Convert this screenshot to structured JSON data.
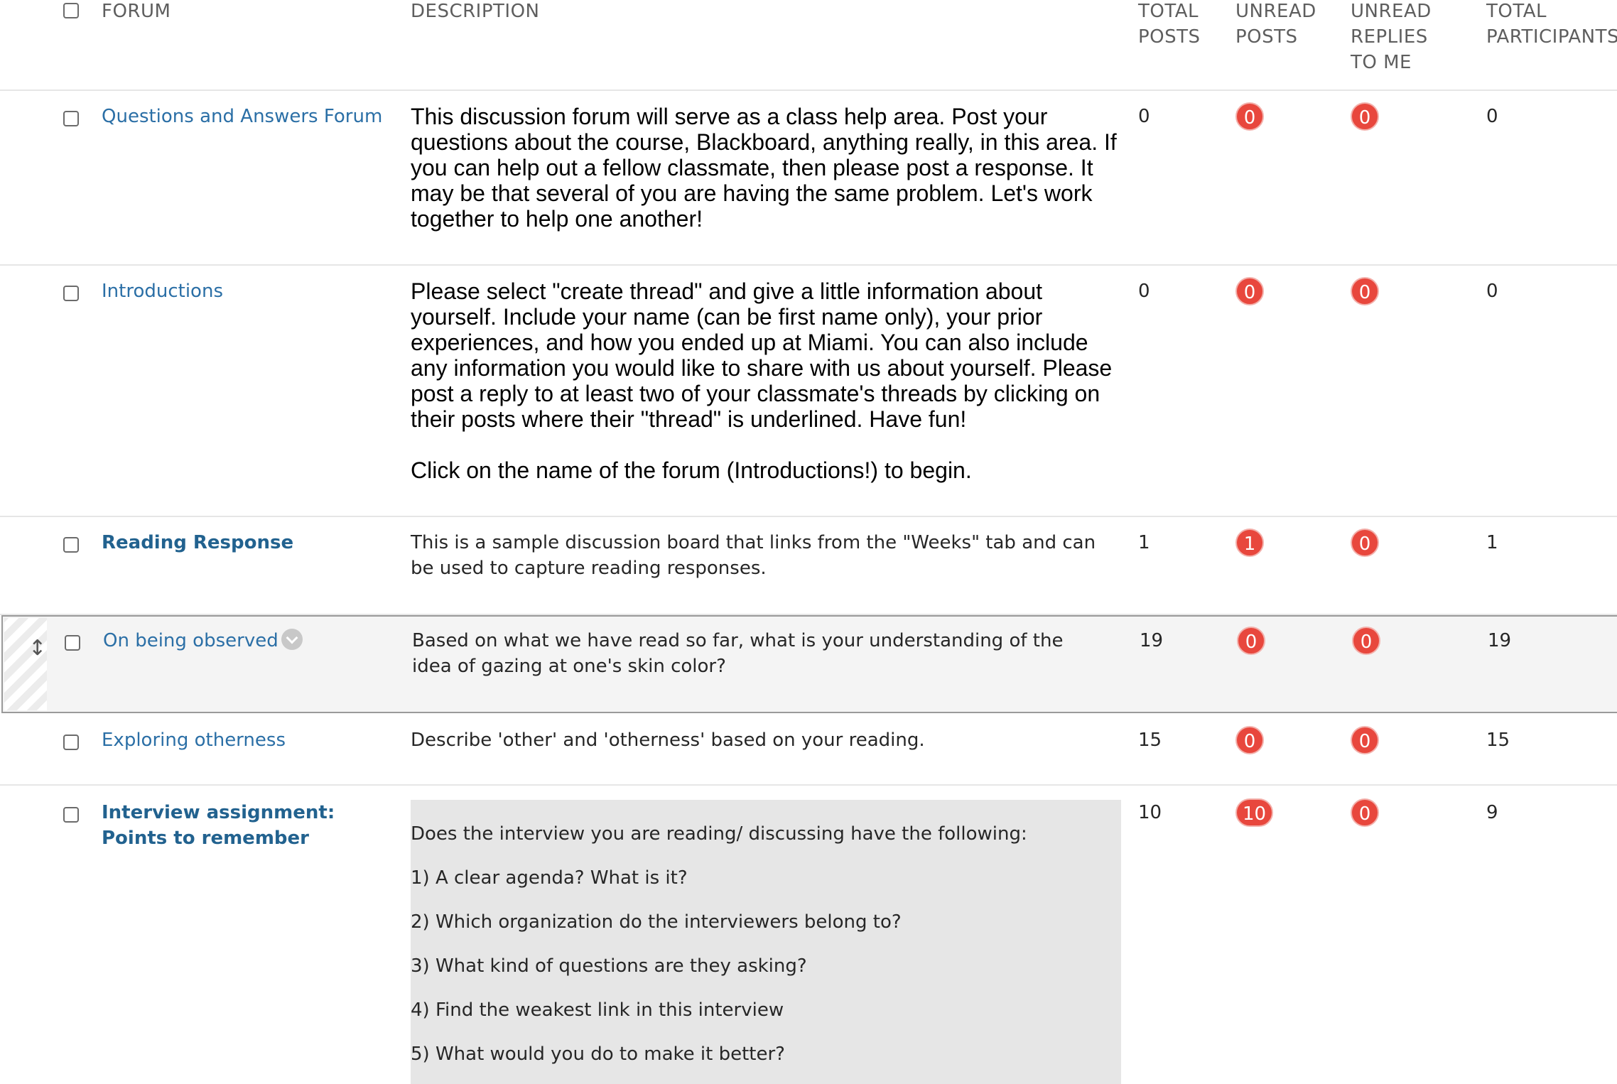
{
  "header": {
    "forum": "FORUM",
    "description": "DESCRIPTION",
    "total_posts": [
      "TOTAL",
      "POSTS"
    ],
    "unread_posts": [
      "UNREAD",
      "POSTS"
    ],
    "unread_replies": [
      "UNREAD",
      "REPLIES",
      "TO ME"
    ],
    "total_participants": [
      "TOTAL",
      "PARTICIPANTS"
    ]
  },
  "rows": [
    {
      "forum": "Questions and Answers Forum",
      "description": "This discussion forum will serve as a class help area. Post your questions about the course, Blackboard, anything really, in this area. If you can help out a fellow classmate, then please post a response. It may be that several of you are having the same problem. Let's work together to help one another!",
      "total_posts": "0",
      "unread_posts": "0",
      "unread_replies": "0",
      "total_participants": "0"
    },
    {
      "forum": "Introductions",
      "description": "Please select \"create thread\" and give a little information about yourself. Include your name (can be first name only), your prior experiences, and how you ended up at Miami. You can also include any information you would like to share with us about yourself. Please post a reply to at least two of your classmate's threads by clicking on their posts where their \"thread\" is underlined. Have fun!",
      "description_2": "Click on the name of the forum (Introductions!) to begin.",
      "total_posts": "0",
      "unread_posts": "0",
      "unread_replies": "0",
      "total_participants": "0"
    },
    {
      "forum": "Reading Response",
      "description": "This is a sample discussion board that links from the \"Weeks\" tab and can be used to capture reading responses.",
      "total_posts": "1",
      "unread_posts": "1",
      "unread_replies": "0",
      "total_participants": "1"
    },
    {
      "forum": "On being observed",
      "description": "Based on what we have read so far, what is your understanding of the idea of gazing at one's skin color?",
      "total_posts": "19",
      "unread_posts": "0",
      "unread_replies": "0",
      "total_participants": "19"
    },
    {
      "forum": "Exploring otherness",
      "description": "Describe 'other' and 'otherness' based on your reading.",
      "total_posts": "15",
      "unread_posts": "0",
      "unread_replies": "0",
      "total_participants": "15"
    },
    {
      "forum": "Interview assignment: Points to remember",
      "description_lines": [
        "Does the interview you are reading/ discussing have the following:",
        "1) A clear agenda? What is it?",
        "2) Which organization do the interviewers belong to?",
        "3) What kind of questions are they asking?",
        "4) Find the weakest link in this interview",
        "5) What would you do to make it better?"
      ],
      "total_posts": "10",
      "unread_posts": "10",
      "unread_replies": "0",
      "total_participants": "9"
    }
  ],
  "icons": {
    "drag_handle": "↕",
    "options": "chevron-down-icon"
  },
  "colors": {
    "link": "#2b6fa6",
    "badge": "#e8473d",
    "highlight_row": "#f4f4f4"
  }
}
